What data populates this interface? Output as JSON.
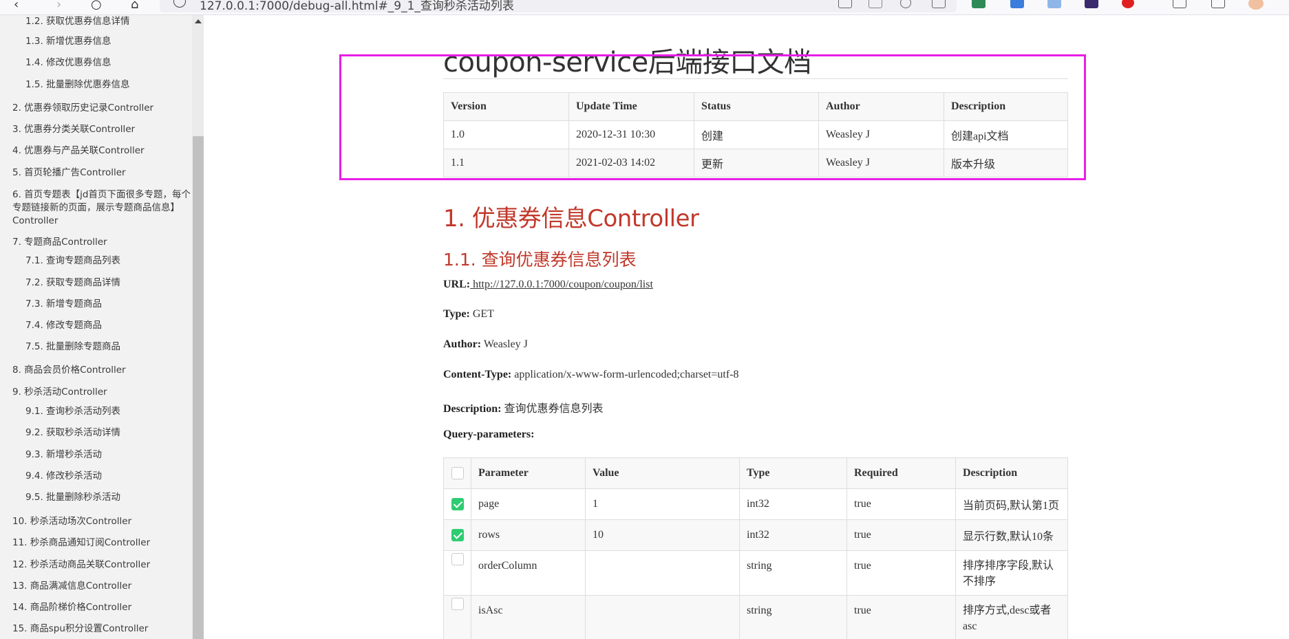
{
  "browser": {
    "url": "127.0.0.1:7000/debug-all.html#_9_1_查询秒杀活动列表"
  },
  "sidebar": {
    "items": [
      {
        "label": "1.2. 获取优惠券信息详情"
      },
      {
        "label": "1.3. 新增优惠券信息"
      },
      {
        "label": "1.4. 修改优惠券信息"
      },
      {
        "label": "1.5. 批量删除优惠券信息"
      },
      {
        "label": "2. 优惠券领取历史记录Controller"
      },
      {
        "label": "3. 优惠券分类关联Controller"
      },
      {
        "label": "4. 优惠券与产品关联Controller"
      },
      {
        "label": "5. 首页轮播广告Controller"
      },
      {
        "label": "6. 首页专题表【jd首页下面很多专题，每个专题链接新的页面，展示专题商品信息】Controller"
      },
      {
        "label": "7. 专题商品Controller"
      },
      {
        "label": "7.1. 查询专题商品列表"
      },
      {
        "label": "7.2. 获取专题商品详情"
      },
      {
        "label": "7.3. 新增专题商品"
      },
      {
        "label": "7.4. 修改专题商品"
      },
      {
        "label": "7.5. 批量删除专题商品"
      },
      {
        "label": "8. 商品会员价格Controller"
      },
      {
        "label": "9. 秒杀活动Controller"
      },
      {
        "label": "9.1. 查询秒杀活动列表"
      },
      {
        "label": "9.2. 获取秒杀活动详情"
      },
      {
        "label": "9.3. 新增秒杀活动"
      },
      {
        "label": "9.4. 修改秒杀活动"
      },
      {
        "label": "9.5. 批量删除秒杀活动"
      },
      {
        "label": "10. 秒杀活动场次Controller"
      },
      {
        "label": "11. 秒杀商品通知订阅Controller"
      },
      {
        "label": "12. 秒杀活动商品关联Controller"
      },
      {
        "label": "13. 商品满减信息Controller"
      },
      {
        "label": "14. 商品阶梯价格Controller"
      },
      {
        "label": "15. 商品spu积分设置Controller"
      }
    ]
  },
  "doc": {
    "title": "coupon-service后端接口文档",
    "version_table": {
      "headers": [
        "Version",
        "Update Time",
        "Status",
        "Author",
        "Description"
      ],
      "rows": [
        [
          "1.0",
          "2020-12-31 10:30",
          "创建",
          "Weasley J",
          "创建api文档"
        ],
        [
          "1.1",
          "2021-02-03 14:02",
          "更新",
          "Weasley J",
          "版本升级"
        ]
      ]
    },
    "h1": "1. 优惠券信息Controller",
    "h2": "1.1. 查询优惠券信息列表",
    "url_label": "URL:",
    "url_value": " http://127.0.0.1:7000/coupon/coupon/list",
    "type_label": "Type:",
    "type_value": " GET",
    "author_label": "Author:",
    "author_value": " Weasley J",
    "ct_label": "Content-Type:",
    "ct_value": " application/x-www-form-urlencoded;charset=utf-8",
    "desc_label": "Description:",
    "desc_value": " 查询优惠券信息列表",
    "query_label": "Query-parameters:",
    "param_table": {
      "headers": [
        "Parameter",
        "Value",
        "Type",
        "Required",
        "Description"
      ],
      "rows": [
        {
          "checked": true,
          "cells": [
            "page",
            "1",
            "int32",
            "true",
            "当前页码,默认第1页"
          ]
        },
        {
          "checked": true,
          "cells": [
            "rows",
            "10",
            "int32",
            "true",
            "显示行数,默认10条"
          ]
        },
        {
          "checked": false,
          "cells": [
            "orderColumn",
            "",
            "string",
            "true",
            "排序排序字段,默认不排序"
          ]
        },
        {
          "checked": false,
          "cells": [
            "isAsc",
            "",
            "string",
            "true",
            "排序方式,desc或者asc"
          ]
        }
      ]
    }
  },
  "colors": {
    "heading": "#c0392b",
    "highlight": "#e61ee6",
    "checkbox_on": "#2ecc71"
  }
}
